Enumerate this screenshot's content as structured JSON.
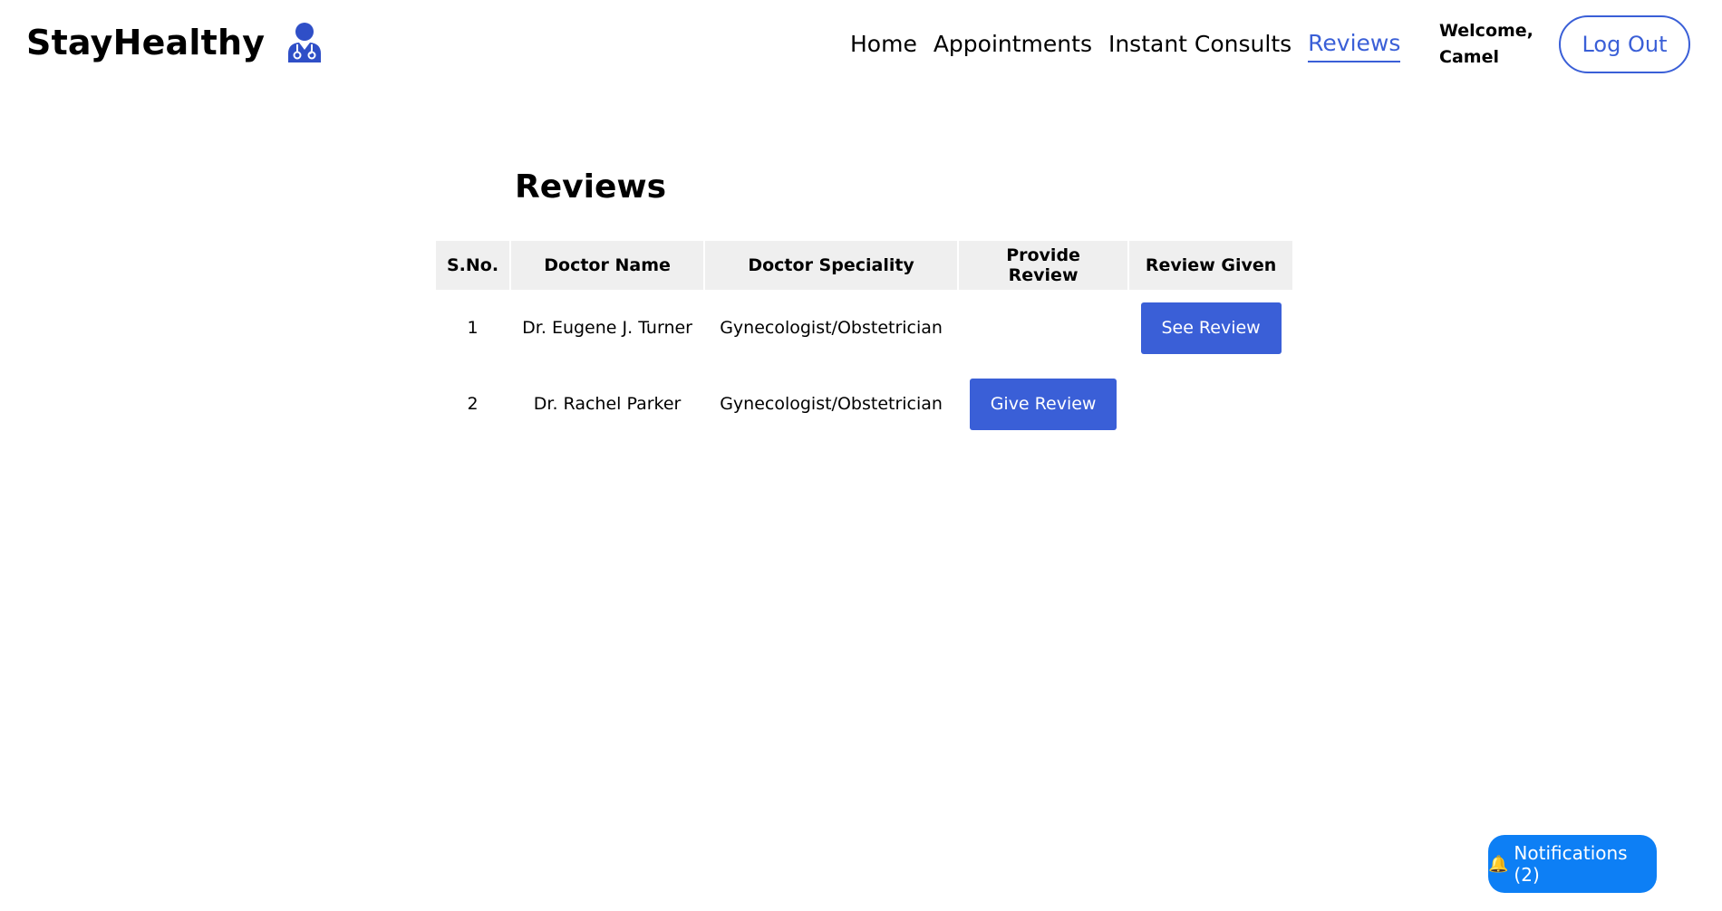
{
  "header": {
    "brand": "StayHealthy",
    "nav": [
      {
        "label": "Home",
        "active": false
      },
      {
        "label": "Appointments",
        "active": false
      },
      {
        "label": "Instant Consults",
        "active": false
      },
      {
        "label": "Reviews",
        "active": true
      }
    ],
    "welcome_line1": "Welcome,",
    "welcome_line2": "Camel",
    "logout_label": "Log Out"
  },
  "main": {
    "title": "Reviews",
    "table": {
      "headers": [
        "S.No.",
        "Doctor Name",
        "Doctor Speciality",
        "Provide Review",
        "Review Given"
      ],
      "rows": [
        {
          "sno": "1",
          "doctor_name": "Dr. Eugene J. Turner",
          "speciality": "Gynecologist/Obstetrician",
          "provide_review": "",
          "review_given": "See Review"
        },
        {
          "sno": "2",
          "doctor_name": "Dr. Rachel Parker",
          "speciality": "Gynecologist/Obstetrician",
          "provide_review": "Give Review",
          "review_given": ""
        }
      ]
    }
  },
  "notifications": {
    "icon": "bell-icon",
    "label": "Notifications (2)"
  },
  "colors": {
    "accent": "#3a5fd7",
    "notification_bg": "#0d7ff5",
    "header_cell_bg": "#efefef"
  }
}
